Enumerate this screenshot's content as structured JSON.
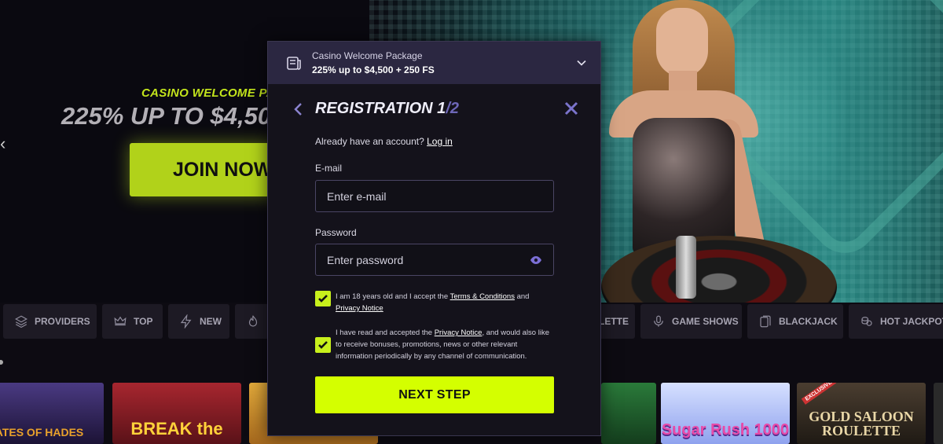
{
  "hero": {
    "promo_subtitle": "CASINO WELCOME PAC",
    "promo_title": "225% UP TO $4,50",
    "join_label": "JOIN NOW"
  },
  "categories": [
    {
      "label": "PROVIDERS",
      "icon": "layers-icon"
    },
    {
      "label": "TOP",
      "icon": "crown-icon"
    },
    {
      "label": "NEW",
      "icon": "lightning-icon"
    },
    {
      "label": "",
      "icon": "flame-icon"
    },
    {
      "label": "LETTE",
      "icon": ""
    },
    {
      "label": "GAME SHOWS",
      "icon": "microphone-icon"
    },
    {
      "label": "BLACKJACK",
      "icon": "cards-icon"
    },
    {
      "label": "HOT JACKPOT",
      "icon": "coins-icon"
    }
  ],
  "games": [
    {
      "title": "ATES OF HADES",
      "color": "#3b2a6b",
      "accent": "#e9a12b"
    },
    {
      "title": "BREAK the",
      "color": "#7d1f27",
      "accent": "#ffd23a"
    },
    {
      "title": "",
      "color": "#c98a2a",
      "accent": "#fff1b0"
    },
    {
      "title": "",
      "color": "#1e5a2e",
      "accent": "#f0c64a"
    },
    {
      "title": "Sugar Rush 1000",
      "color": "#b7c7ff",
      "accent": "#e84aa8"
    },
    {
      "title": "GOLD SALOON ROULETTE",
      "color": "#3a3026",
      "accent": "#e9d7a7",
      "badge": "EXCLUSIVE"
    }
  ],
  "modal": {
    "package_title": "Casino Welcome Package",
    "package_value": "225% up to $4,500 + 250 FS",
    "reg_title": "REGISTRATION 1",
    "reg_total": "/2",
    "account_text": "Already have an account?",
    "login_link": "Log in",
    "email_label": "E-mail",
    "email_placeholder": "Enter e-mail",
    "email_value": "",
    "password_label": "Password",
    "password_placeholder": "Enter password",
    "password_value": "",
    "terms_pre": "I am 18 years old and I accept the",
    "terms_link": "Terms & Conditions",
    "terms_and": "and",
    "privacy_link": "Privacy Notice",
    "marketing_pre": "I have read and accepted the",
    "marketing_privacy_link": "Privacy Notice",
    "marketing_post": ", and would also like to receive bonuses, promotions, news or other relevant information periodically by any channel of communication.",
    "terms_checked": true,
    "marketing_checked": true,
    "next_label": "NEXT STEP",
    "accent_color": "#d4ff00"
  }
}
